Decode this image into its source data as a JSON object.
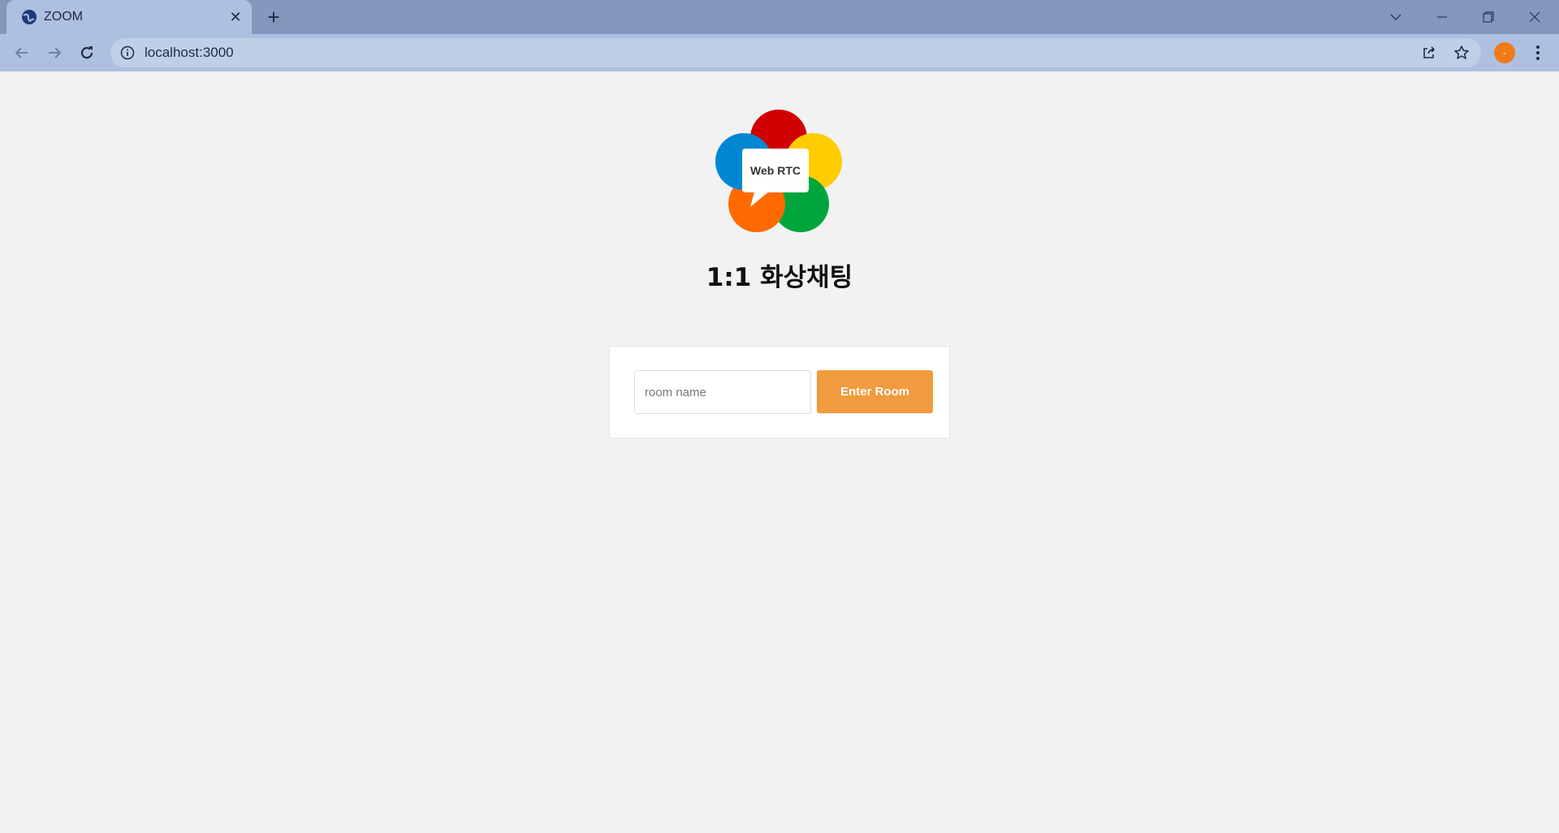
{
  "browser": {
    "tab": {
      "title": "ZOOM",
      "close_glyph": "✕"
    },
    "new_tab_glyph": "+",
    "address_bar": {
      "url": "localhost:3000"
    },
    "profile_initial": "-"
  },
  "page": {
    "logo_text": "Web RTC",
    "heading": "1:1 화상채팅",
    "form": {
      "input_placeholder": "room name",
      "input_value": "",
      "button_label": "Enter Room"
    }
  },
  "colors": {
    "accent": "#f19a3e",
    "chrome": "#aec0e0",
    "tabstrip": "#8497bd",
    "background": "#f2f2f2"
  }
}
